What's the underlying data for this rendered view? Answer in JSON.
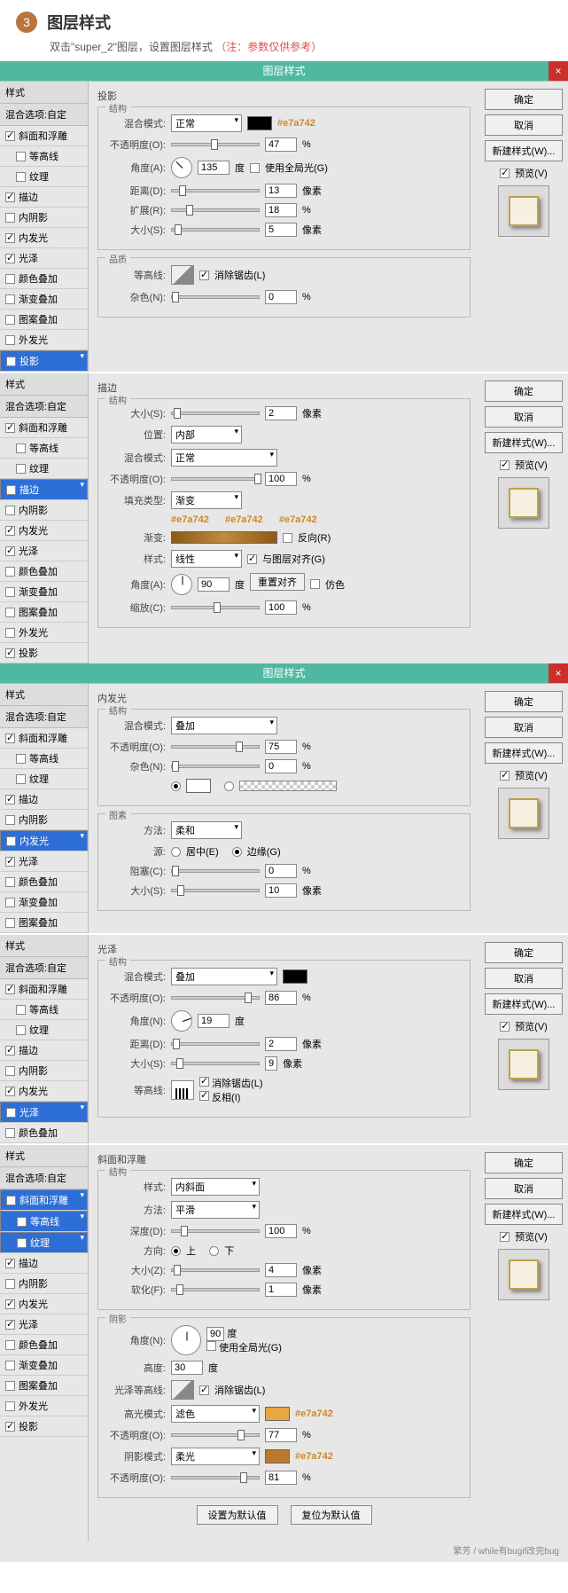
{
  "header": {
    "step": "3",
    "title": "图层样式",
    "sub": "双击\"super_2\"图层，设置图层样式",
    "note": "（注：参数仅供参考）"
  },
  "dialog_title": "图层样式",
  "buttons": {
    "ok": "确定",
    "cancel": "取消",
    "new_style": "新建样式(W)...",
    "preview": "预览(V)"
  },
  "sidebar_labels": {
    "style": "样式",
    "blend_opts": "混合选项:自定",
    "bevel": "斜面和浮雕",
    "contour": "等高线",
    "texture": "纹理",
    "stroke": "描边",
    "inner_shadow": "内阴影",
    "inner_glow": "内发光",
    "satin": "光泽",
    "color_overlay": "颜色叠加",
    "gradient_overlay": "渐变叠加",
    "pattern_overlay": "图案叠加",
    "outer_glow": "外发光",
    "drop_shadow": "投影"
  },
  "panel1": {
    "section": "投影",
    "group": "结构",
    "blend_mode_lbl": "混合模式:",
    "blend_mode": "正常",
    "color": "#e7a742",
    "opacity_lbl": "不透明度(O):",
    "opacity": "47",
    "pct": "%",
    "angle_lbl": "角度(A):",
    "angle": "135",
    "deg": "度",
    "global_light": "使用全局光(G)",
    "distance_lbl": "距离(D):",
    "distance": "13",
    "px": "像素",
    "spread_lbl": "扩展(R):",
    "spread": "18",
    "size_lbl": "大小(S):",
    "size": "5",
    "quality": "品质",
    "contour_lbl": "等高线:",
    "antialias": "消除锯齿(L)",
    "noise_lbl": "杂色(N):",
    "noise": "0"
  },
  "panel2": {
    "section": "描边",
    "group": "结构",
    "size_lbl": "大小(S):",
    "size": "2",
    "px": "像素",
    "position_lbl": "位置:",
    "position": "内部",
    "blend_mode_lbl": "混合模式:",
    "blend_mode": "正常",
    "opacity_lbl": "不透明度(O):",
    "opacity": "100",
    "pct": "%",
    "fill_type_lbl": "填充类型:",
    "fill_type": "渐变",
    "c1": "#e7a742",
    "c2": "#e7a742",
    "c3": "#e7a742",
    "gradient_lbl": "渐变:",
    "reverse": "反向(R)",
    "style_lbl": "样式:",
    "style": "线性",
    "align_layer": "与图层对齐(G)",
    "angle_lbl": "角度(A):",
    "angle": "90",
    "deg": "度",
    "reset_align": "重置对齐",
    "dither": "仿色",
    "scale_lbl": "缩放(C):",
    "scale": "100"
  },
  "panel3": {
    "section": "内发光",
    "group": "结构",
    "blend_mode_lbl": "混合模式:",
    "blend_mode": "叠加",
    "opacity_lbl": "不透明度(O):",
    "opacity": "75",
    "pct": "%",
    "noise_lbl": "杂色(N):",
    "noise": "0",
    "elements": "图素",
    "technique_lbl": "方法:",
    "technique": "柔和",
    "source_lbl": "源:",
    "source_center": "居中(E)",
    "source_edge": "边缘(G)",
    "choke_lbl": "阻塞(C):",
    "choke": "0",
    "size_lbl": "大小(S):",
    "size": "10",
    "px": "像素"
  },
  "panel4": {
    "section": "光泽",
    "group": "结构",
    "blend_mode_lbl": "混合模式:",
    "blend_mode": "叠加",
    "opacity_lbl": "不透明度(O):",
    "opacity": "86",
    "pct": "%",
    "angle_lbl": "角度(N):",
    "angle": "19",
    "deg": "度",
    "distance_lbl": "距离(D):",
    "distance": "2",
    "px": "像素",
    "size_lbl": "大小(S):",
    "size": "9",
    "contour_lbl": "等高线:",
    "antialias": "消除锯齿(L)",
    "invert": "反相(I)"
  },
  "panel5": {
    "section": "斜面和浮雕",
    "group": "结构",
    "style_lbl": "样式:",
    "style": "内斜面",
    "technique_lbl": "方法:",
    "technique": "平滑",
    "depth_lbl": "深度(D):",
    "depth": "100",
    "pct": "%",
    "direction_lbl": "方向:",
    "dir_up": "上",
    "dir_down": "下",
    "size_lbl": "大小(Z):",
    "size": "4",
    "px": "像素",
    "soften_lbl": "软化(F):",
    "soften": "1",
    "shading": "阴影",
    "angle_lbl": "角度(N):",
    "angle": "90",
    "deg": "度",
    "global_light": "使用全局光(G)",
    "altitude_lbl": "高度:",
    "altitude": "30",
    "gloss_contour_lbl": "光泽等高线:",
    "antialias": "消除锯齿(L)",
    "highlight_mode_lbl": "高光模式:",
    "highlight_mode": "滤色",
    "highlight_color": "#e7a742",
    "h_opacity_lbl": "不透明度(O):",
    "h_opacity": "77",
    "shadow_mode_lbl": "阴影模式:",
    "shadow_mode": "柔光",
    "shadow_color": "#e7a742",
    "s_opacity_lbl": "不透明度(O):",
    "s_opacity": "81",
    "default_btn": "设置为默认值",
    "reset_btn": "复位为默认值"
  },
  "footer": "繁芳 / while有bugif改完bug"
}
